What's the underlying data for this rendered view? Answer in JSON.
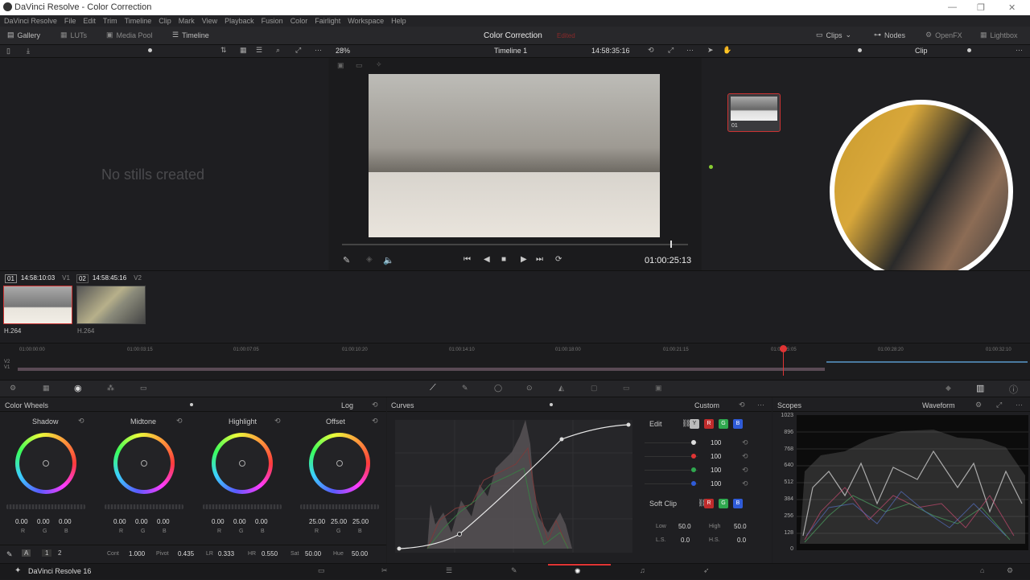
{
  "window": {
    "title": "DaVinci Resolve - Color Correction"
  },
  "menu": [
    "DaVinci Resolve",
    "File",
    "Edit",
    "Trim",
    "Timeline",
    "Clip",
    "Mark",
    "View",
    "Playback",
    "Fusion",
    "Color",
    "Fairlight",
    "Workspace",
    "Help"
  ],
  "toolbar": {
    "gallery": "Gallery",
    "luts": "LUTs",
    "media_pool": "Media Pool",
    "timeline": "Timeline",
    "page_title": "Color Correction",
    "page_status": "Edited",
    "clips": "Clips",
    "nodes": "Nodes",
    "openfx": "OpenFX",
    "lightbox": "Lightbox"
  },
  "viewer": {
    "zoom": "28%",
    "timeline_name": "Timeline 1",
    "source_tc": "14:58:35:16",
    "timecode": "01:00:25:13",
    "mode": "Clip"
  },
  "gallery": {
    "empty": "No stills created"
  },
  "node": {
    "label": "01"
  },
  "clips": [
    {
      "index": "01",
      "tc": "14:58:10:03",
      "track": "V1",
      "codec": "H.264"
    },
    {
      "index": "02",
      "tc": "14:58:45:16",
      "track": "V2",
      "codec": "H.264"
    }
  ],
  "ruler": [
    "01:00:00:00",
    "01:00:03:15",
    "01:00:07:05",
    "01:00:10:20",
    "01:00:14:10",
    "01:00:18:00",
    "01:00:21:15",
    "01:00:25:05",
    "01:00:28:20",
    "01:00:32:10"
  ],
  "tracks": {
    "v2": "V2",
    "v1": "V1"
  },
  "color_wheels": {
    "title": "Color Wheels",
    "mode": "Log",
    "wheels": [
      {
        "name": "Shadow",
        "r": "0.00",
        "g": "0.00",
        "b": "0.00"
      },
      {
        "name": "Midtone",
        "r": "0.00",
        "g": "0.00",
        "b": "0.00"
      },
      {
        "name": "Highlight",
        "r": "0.00",
        "g": "0.00",
        "b": "0.00"
      },
      {
        "name": "Offset",
        "r": "25.00",
        "g": "25.00",
        "b": "25.00"
      }
    ],
    "ch": {
      "r": "R",
      "g": "G",
      "b": "B"
    },
    "params": {
      "page_a": "A",
      "page1": "1",
      "page2": "2",
      "cont_l": "Cont",
      "cont": "1.000",
      "pivot_l": "Pivot",
      "pivot": "0.435",
      "lr_l": "LR",
      "lr": "0.333",
      "hr_l": "HR",
      "hr": "0.550",
      "sat_l": "Sat",
      "sat": "50.00",
      "hue_l": "Hue",
      "hue": "50.00"
    }
  },
  "curves": {
    "title": "Curves",
    "mode": "Custom",
    "edit": "Edit",
    "channels": [
      "Y",
      "R",
      "G",
      "B"
    ],
    "values": [
      "100",
      "100",
      "100",
      "100"
    ],
    "soft_clip": "Soft Clip",
    "low_l": "Low",
    "low": "50.0",
    "high_l": "High",
    "high": "50.0",
    "ls_l": "L.S.",
    "ls": "0.0",
    "hs_l": "H.S.",
    "hs": "0.0"
  },
  "scopes": {
    "title": "Scopes",
    "mode": "Waveform",
    "ticks": [
      "1023",
      "896",
      "768",
      "640",
      "512",
      "384",
      "256",
      "128",
      "0"
    ]
  },
  "footer": {
    "app": "DaVinci Resolve 16"
  },
  "colors": {
    "accent_red": "#e03434",
    "green": "#2fa84f",
    "blue": "#2f5bd8"
  }
}
